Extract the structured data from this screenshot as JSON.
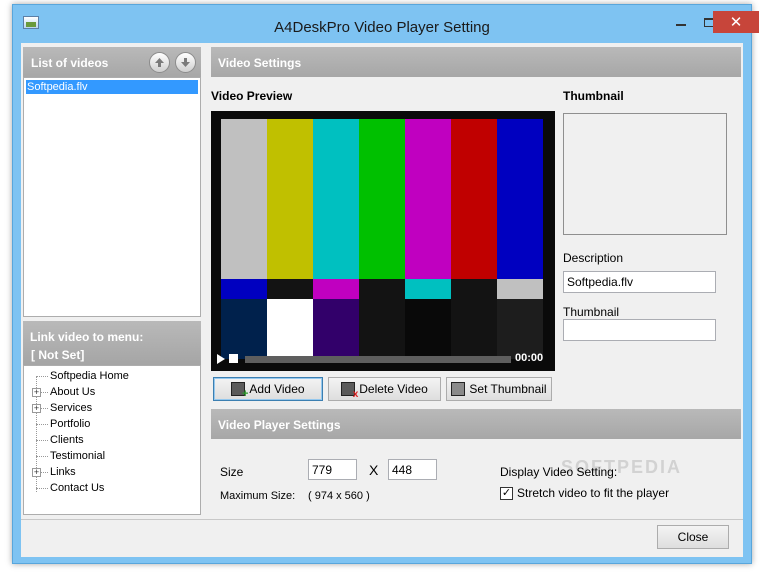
{
  "window": {
    "title": "A4DeskPro Video Player Setting",
    "close_glyph": "✕",
    "minimize_glyph": "",
    "maximize_glyph": ""
  },
  "videos_panel": {
    "header": "List of videos",
    "up_icon": "arrow-up-icon",
    "down_icon": "arrow-down-icon",
    "items": [
      "Softpedia.flv"
    ]
  },
  "menu_panel": {
    "header": "Link video to menu:",
    "current": "[ Not Set]",
    "tree": [
      {
        "label": "Softpedia Home",
        "expandable": false
      },
      {
        "label": "About Us",
        "expandable": true
      },
      {
        "label": "Services",
        "expandable": true
      },
      {
        "label": "Portfolio",
        "expandable": false
      },
      {
        "label": "Clients",
        "expandable": false
      },
      {
        "label": "Testimonial",
        "expandable": false
      },
      {
        "label": "Links",
        "expandable": true
      },
      {
        "label": "Contact Us",
        "expandable": false
      }
    ]
  },
  "video_settings": {
    "header": "Video Settings",
    "preview_label": "Video Preview",
    "thumbnail_label": "Thumbnail",
    "time": "00:00",
    "description_label": "Description",
    "description_value": "Softpedia.flv",
    "thumbnail_field_label": "Thumbnail",
    "thumbnail_value": "",
    "add_video": "Add Video",
    "delete_video": "Delete Video",
    "set_thumbnail": "Set Thumbnail"
  },
  "player_settings": {
    "header": "Video Player Settings",
    "size_label": "Size",
    "width": "779",
    "separator": "X",
    "height": "448",
    "max_size_label": "Maximum Size:",
    "max_size_value": "( 974 x 560 )",
    "display_label": "Display Video Setting:",
    "stretch_label": "Stretch video to fit the player",
    "stretch_checked": true
  },
  "footer": {
    "close": "Close"
  },
  "colors": {
    "title_bar": "#7ec3f2",
    "header_gray": "#b0b0b0",
    "selection": "#3399ff",
    "close_red": "#c7453a"
  },
  "test_pattern": {
    "top": [
      "#c0c0c0",
      "#c0c000",
      "#00c0c0",
      "#00c000",
      "#c000c0",
      "#c00000",
      "#0000c0"
    ],
    "middle": [
      "#0000c0",
      "#131313",
      "#c000c0",
      "#131313",
      "#00c0c0",
      "#131313",
      "#c0c0c0"
    ],
    "bottom": [
      "#00214c",
      "#ffffff",
      "#32006a",
      "#131313",
      "#090909",
      "#131313",
      "#1d1d1d"
    ]
  },
  "watermark": "SOFTPEDIA"
}
